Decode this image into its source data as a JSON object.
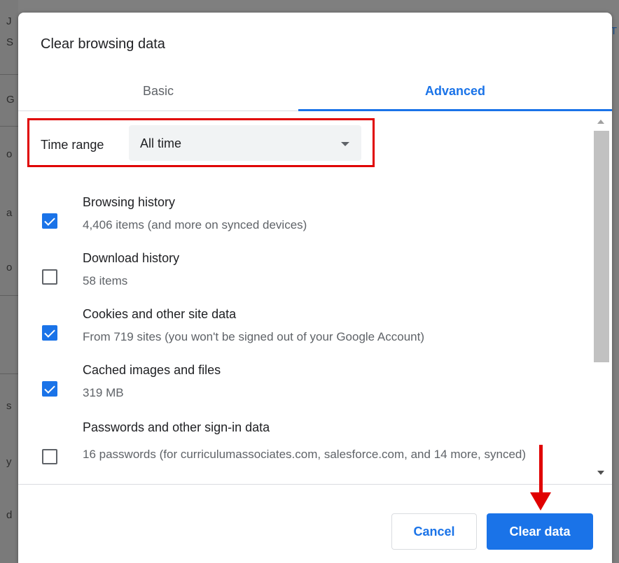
{
  "background": {
    "left_letters": [
      "J",
      "S",
      "G",
      "o",
      "a",
      "o",
      "s",
      "y",
      "d"
    ],
    "right_letter": "T"
  },
  "dialog": {
    "title": "Clear browsing data",
    "tabs": [
      {
        "label": "Basic",
        "selected": false
      },
      {
        "label": "Advanced",
        "selected": true
      }
    ]
  },
  "time_range": {
    "label": "Time range",
    "value": "All time"
  },
  "items": [
    {
      "title": "Browsing history",
      "description": "4,406 items (and more on synced devices)",
      "checked": true
    },
    {
      "title": "Download history",
      "description": "58 items",
      "checked": false
    },
    {
      "title": "Cookies and other site data",
      "description": "From 719 sites (you won't be signed out of your Google Account)",
      "checked": true
    },
    {
      "title": "Cached images and files",
      "description": "319 MB",
      "checked": true
    },
    {
      "title": "Passwords and other sign-in data",
      "description": "16 passwords (for curriculumassociates.com, salesforce.com, and 14 more, synced)",
      "checked": false
    }
  ],
  "footer": {
    "cancel_label": "Cancel",
    "clear_label": "Clear data"
  },
  "colors": {
    "accent": "#1a73e8",
    "annotation": "#e00000"
  }
}
